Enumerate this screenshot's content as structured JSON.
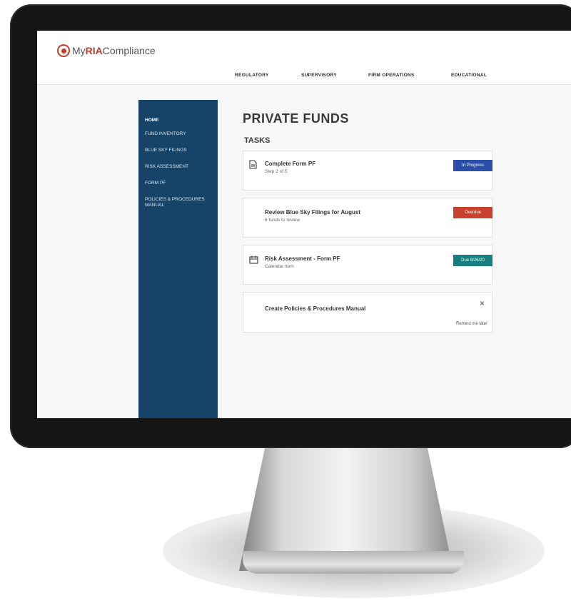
{
  "app": {
    "brand_prefix": "My",
    "brand_ria": "RIA",
    "brand_suffix": "Compliance"
  },
  "nav": {
    "items": [
      "REGULATORY",
      "SUPERVISORY",
      "FIRM OPERATIONS",
      "EDUCATIONAL"
    ]
  },
  "sidebar": {
    "items": [
      {
        "label": "HOME",
        "active": true
      },
      {
        "label": "FUND INVENTORY",
        "active": false
      },
      {
        "label": "BLUE SKY FILINGS",
        "active": false
      },
      {
        "label": "RISK ASSESSMENT",
        "active": false
      },
      {
        "label": "FORM PF",
        "active": false
      },
      {
        "label": "POLICIES & PROCEDURES MANUAL",
        "active": false
      }
    ]
  },
  "main": {
    "title": "PRIVATE FUNDS",
    "section": "TASKS",
    "tasks": [
      {
        "title": "Complete Form PF",
        "subtitle": "Step 2 of 5",
        "badge": "In Progress",
        "badge_color": "#2b4fa8",
        "icon": "document-icon"
      },
      {
        "title": "Review Blue Sky Filings for August",
        "subtitle": "6 funds to review",
        "badge": "Overdue",
        "badge_color": "#c8412e",
        "icon": ""
      },
      {
        "title": "Risk Assessment - Form PF",
        "subtitle": "Calendar Item",
        "badge": "Due 8/26/20",
        "badge_color": "#177d7e",
        "icon": "calendar-icon"
      },
      {
        "title": "Create Policies & Procedures Manual",
        "subtitle": "",
        "close": "×",
        "remind": "Remind me later"
      }
    ]
  },
  "colors": {
    "sidebar": "#154468",
    "accent": "#c33b2b"
  }
}
